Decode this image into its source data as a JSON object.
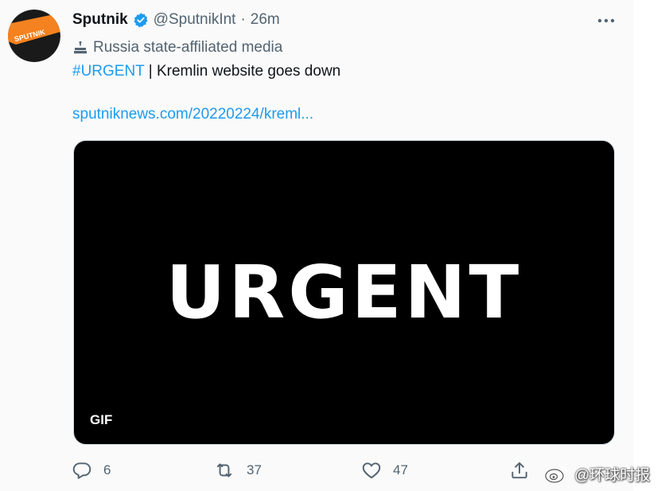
{
  "tweet": {
    "display_name": "Sputnik",
    "handle": "@SputnikInt",
    "separator": "·",
    "time": "26m",
    "label": "Russia state-affiliated media",
    "hashtag": "#URGENT",
    "text_rest": " | Kremlin website goes down",
    "link": "sputniknews.com/20220224/kreml...",
    "verified_color": "#1d9bf0"
  },
  "avatar": {
    "logo_text": "SPUTNIK",
    "brand_color": "#f58220"
  },
  "media": {
    "headline": "URGENT",
    "badge": "GIF"
  },
  "actions": {
    "reply_count": "6",
    "retweet_count": "37",
    "like_count": "47"
  },
  "watermark": {
    "text": "@环球时报"
  }
}
